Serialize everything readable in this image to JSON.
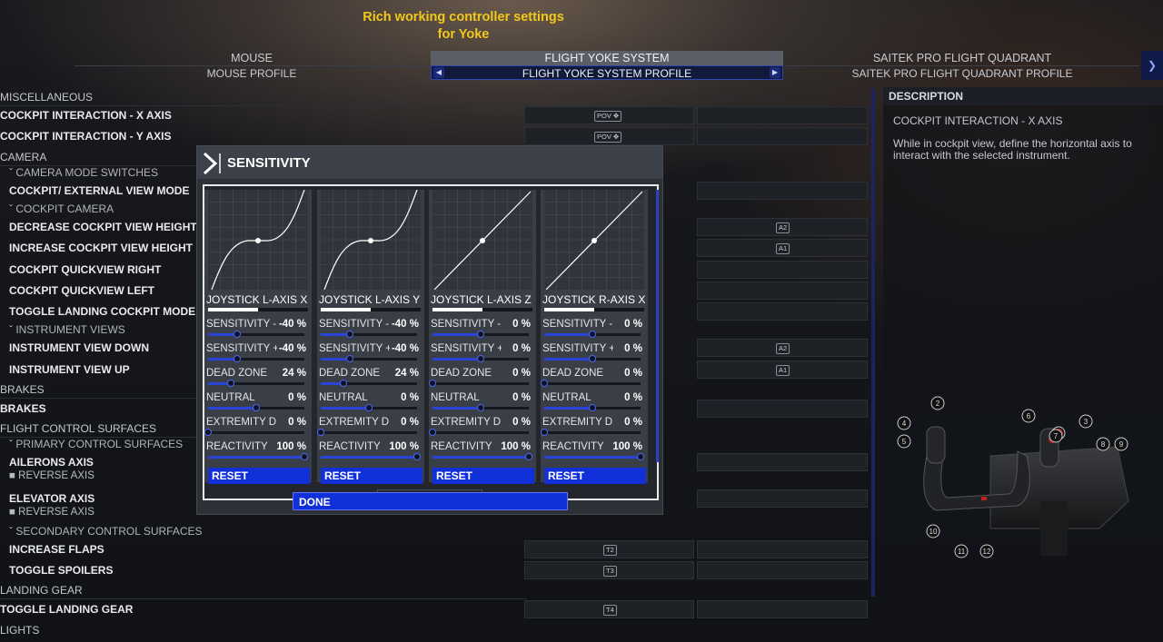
{
  "banner": {
    "line1": "Rich working controller settings",
    "line2": "for Yoke"
  },
  "devices": [
    {
      "name": "MOUSE",
      "profile": "MOUSE PROFILE"
    },
    {
      "name": "FLIGHT YOKE SYSTEM",
      "profile": "FLIGHT YOKE SYSTEM PROFILE",
      "selected": true
    },
    {
      "name": "SAITEK PRO FLIGHT QUADRANT",
      "profile": "SAITEK PRO FLIGHT QUADRANT PROFILE"
    }
  ],
  "list": {
    "misc": "MISCELLANEOUS",
    "cockpit_x": "COCKPIT INTERACTION - X AXIS",
    "cockpit_y": "COCKPIT INTERACTION - Y AXIS",
    "camera": "CAMERA",
    "camera_mode": "CAMERA MODE SWITCHES",
    "cockpit_ext": "COCKPIT/ EXTERNAL VIEW MODE",
    "cockpit_camera": "COCKPIT CAMERA",
    "dec_height": "DECREASE COCKPIT VIEW HEIGHT",
    "inc_height": "INCREASE COCKPIT VIEW HEIGHT",
    "qv_right": "COCKPIT QUICKVIEW RIGHT",
    "qv_left": "COCKPIT QUICKVIEW LEFT",
    "toggle_landing_cockpit": "TOGGLE LANDING COCKPIT MODE",
    "instrument_views": "INSTRUMENT VIEWS",
    "iv_down": "INSTRUMENT VIEW DOWN",
    "iv_up": "INSTRUMENT VIEW UP",
    "brakes_cat": "BRAKES",
    "brakes": "BRAKES",
    "fcs": "FLIGHT CONTROL SURFACES",
    "pcs": "PRIMARY CONTROL SURFACES",
    "ailerons": "AILERONS AXIS",
    "reverse1": "REVERSE AXIS",
    "elevator": "ELEVATOR AXIS",
    "reverse2": "REVERSE AXIS",
    "scs": "SECONDARY CONTROL SURFACES",
    "inc_flaps": "INCREASE FLAPS",
    "toggle_spoilers": "TOGGLE SPOILERS",
    "landing_gear": "LANDING GEAR",
    "toggle_gear": "TOGGLE LANDING GEAR",
    "lights": "LIGHTS",
    "keys": {
      "pov": "POV ✥",
      "a2": "A2",
      "a1": "A1",
      "t2": "T2",
      "t3": "T3",
      "t4": "T4"
    }
  },
  "description": {
    "header": "DESCRIPTION",
    "title": "COCKPIT INTERACTION - X AXIS",
    "text": "While in cockpit view, define the horizontal axis to interact with the selected instrument.",
    "callouts": [
      "1",
      "2",
      "3",
      "4",
      "5",
      "6",
      "7",
      "8",
      "9",
      "10",
      "11",
      "12"
    ]
  },
  "modal": {
    "title": "SENSITIVITY",
    "done": "DONE",
    "axes": [
      {
        "name": "JOYSTICK L-AXIS X",
        "curve": "s",
        "rows": [
          {
            "label": "SENSITIVITY -",
            "value": "-40 %",
            "level": 0.3
          },
          {
            "label": "SENSITIVITY +",
            "value": "-40 %",
            "level": 0.3
          },
          {
            "label": "DEAD ZONE",
            "value": "24 %",
            "level": 0.24
          },
          {
            "label": "NEUTRAL",
            "value": "0 %",
            "level": 0.5
          },
          {
            "label": "EXTREMITY DEAD ZONE",
            "value": "0 %",
            "level": 0.0
          },
          {
            "label": "REACTIVITY",
            "value": "100 %",
            "level": 1.0
          }
        ],
        "reset": "RESET"
      },
      {
        "name": "JOYSTICK L-AXIS Y",
        "curve": "s",
        "rows": [
          {
            "label": "SENSITIVITY -",
            "value": "-40 %",
            "level": 0.3
          },
          {
            "label": "SENSITIVITY +",
            "value": "-40 %",
            "level": 0.3
          },
          {
            "label": "DEAD ZONE",
            "value": "24 %",
            "level": 0.24
          },
          {
            "label": "NEUTRAL",
            "value": "0 %",
            "level": 0.5
          },
          {
            "label": "EXTREMITY DEAD ZONE",
            "value": "0 %",
            "level": 0.0
          },
          {
            "label": "REACTIVITY",
            "value": "100 %",
            "level": 1.0
          }
        ],
        "reset": "RESET"
      },
      {
        "name": "JOYSTICK L-AXIS Z",
        "curve": "linear",
        "rows": [
          {
            "label": "SENSITIVITY -",
            "value": "0 %",
            "level": 0.5
          },
          {
            "label": "SENSITIVITY +",
            "value": "0 %",
            "level": 0.5
          },
          {
            "label": "DEAD ZONE",
            "value": "0 %",
            "level": 0.0
          },
          {
            "label": "NEUTRAL",
            "value": "0 %",
            "level": 0.5
          },
          {
            "label": "EXTREMITY DEAD ZONE",
            "value": "0 %",
            "level": 0.0
          },
          {
            "label": "REACTIVITY",
            "value": "100 %",
            "level": 1.0
          }
        ],
        "reset": "RESET"
      },
      {
        "name": "JOYSTICK R-AXIS X",
        "curve": "linear",
        "rows": [
          {
            "label": "SENSITIVITY -",
            "value": "0 %",
            "level": 0.5
          },
          {
            "label": "SENSITIVITY +",
            "value": "0 %",
            "level": 0.5
          },
          {
            "label": "DEAD ZONE",
            "value": "0 %",
            "level": 0.0
          },
          {
            "label": "NEUTRAL",
            "value": "0 %",
            "level": 0.5
          },
          {
            "label": "EXTREMITY DEAD ZONE",
            "value": "0 %",
            "level": 0.0
          },
          {
            "label": "REACTIVITY",
            "value": "100 %",
            "level": 1.0
          }
        ],
        "reset": "RESET"
      }
    ]
  }
}
